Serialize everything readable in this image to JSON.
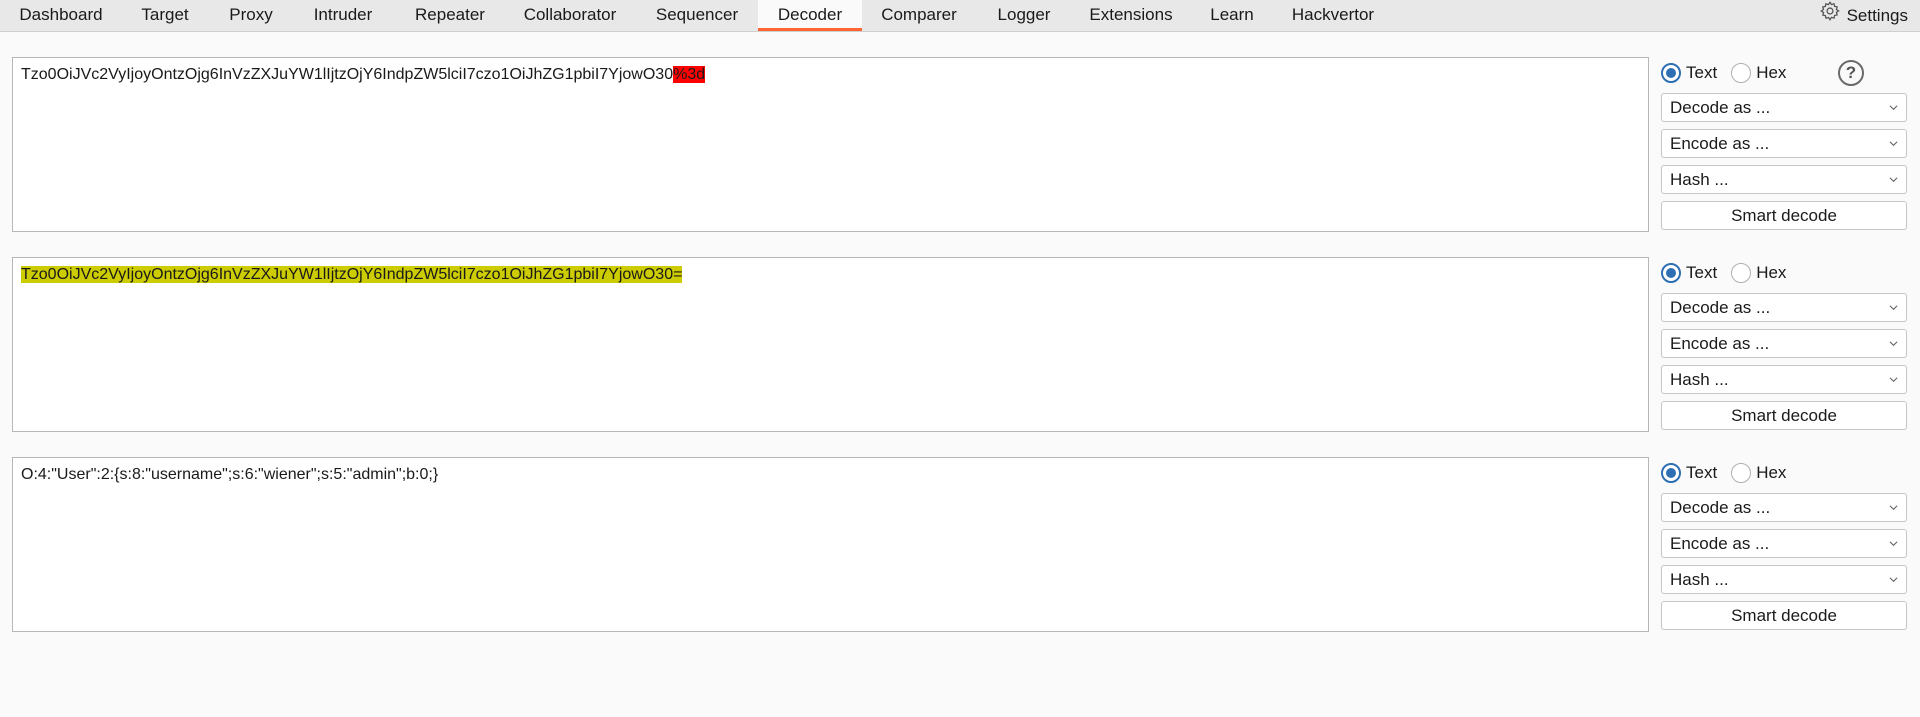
{
  "tabs": [
    {
      "label": "Dashboard",
      "active": false
    },
    {
      "label": "Target",
      "active": false
    },
    {
      "label": "Proxy",
      "active": false
    },
    {
      "label": "Intruder",
      "active": false
    },
    {
      "label": "Repeater",
      "active": false
    },
    {
      "label": "Collaborator",
      "active": false
    },
    {
      "label": "Sequencer",
      "active": false
    },
    {
      "label": "Decoder",
      "active": true
    },
    {
      "label": "Comparer",
      "active": false
    },
    {
      "label": "Logger",
      "active": false
    },
    {
      "label": "Extensions",
      "active": false
    },
    {
      "label": "Learn",
      "active": false
    },
    {
      "label": "Hackvertor",
      "active": false
    }
  ],
  "settings_label": "Settings",
  "accent_color": "#ff6633",
  "panels": [
    {
      "text_prefix": "Tzo0OiJVc2VyIjoyOntzOjg6InVzZXJuYW1lIjtzOjY6IndpZW5lciI7czo1OiJhZG1pbiI7YjowO30",
      "text_highlight": "%3d",
      "highlight_color": "#ff0000",
      "mode_text": "Text",
      "mode_hex": "Hex",
      "selected_mode": "Text",
      "decode_label": "Decode as ...",
      "encode_label": "Encode as ...",
      "hash_label": "Hash ...",
      "smart_decode_label": "Smart decode",
      "show_help": true
    },
    {
      "text_prefix": "",
      "text_highlight": "Tzo0OiJVc2VyIjoyOntzOjg6InVzZXJuYW1lIjtzOjY6IndpZW5lciI7czo1OiJhZG1pbiI7YjowO30=",
      "highlight_color": "#cccc00",
      "mode_text": "Text",
      "mode_hex": "Hex",
      "selected_mode": "Text",
      "decode_label": "Decode as ...",
      "encode_label": "Encode as ...",
      "hash_label": "Hash ...",
      "smart_decode_label": "Smart decode",
      "show_help": false
    },
    {
      "text_prefix": "O:4:\"User\":2:{s:8:\"username\";s:6:\"wiener\";s:5:\"admin\";b:0;}",
      "text_highlight": "",
      "highlight_color": "",
      "mode_text": "Text",
      "mode_hex": "Hex",
      "selected_mode": "Text",
      "decode_label": "Decode as ...",
      "encode_label": "Encode as ...",
      "hash_label": "Hash ...",
      "smart_decode_label": "Smart decode",
      "show_help": false
    }
  ],
  "help_symbol": "?"
}
